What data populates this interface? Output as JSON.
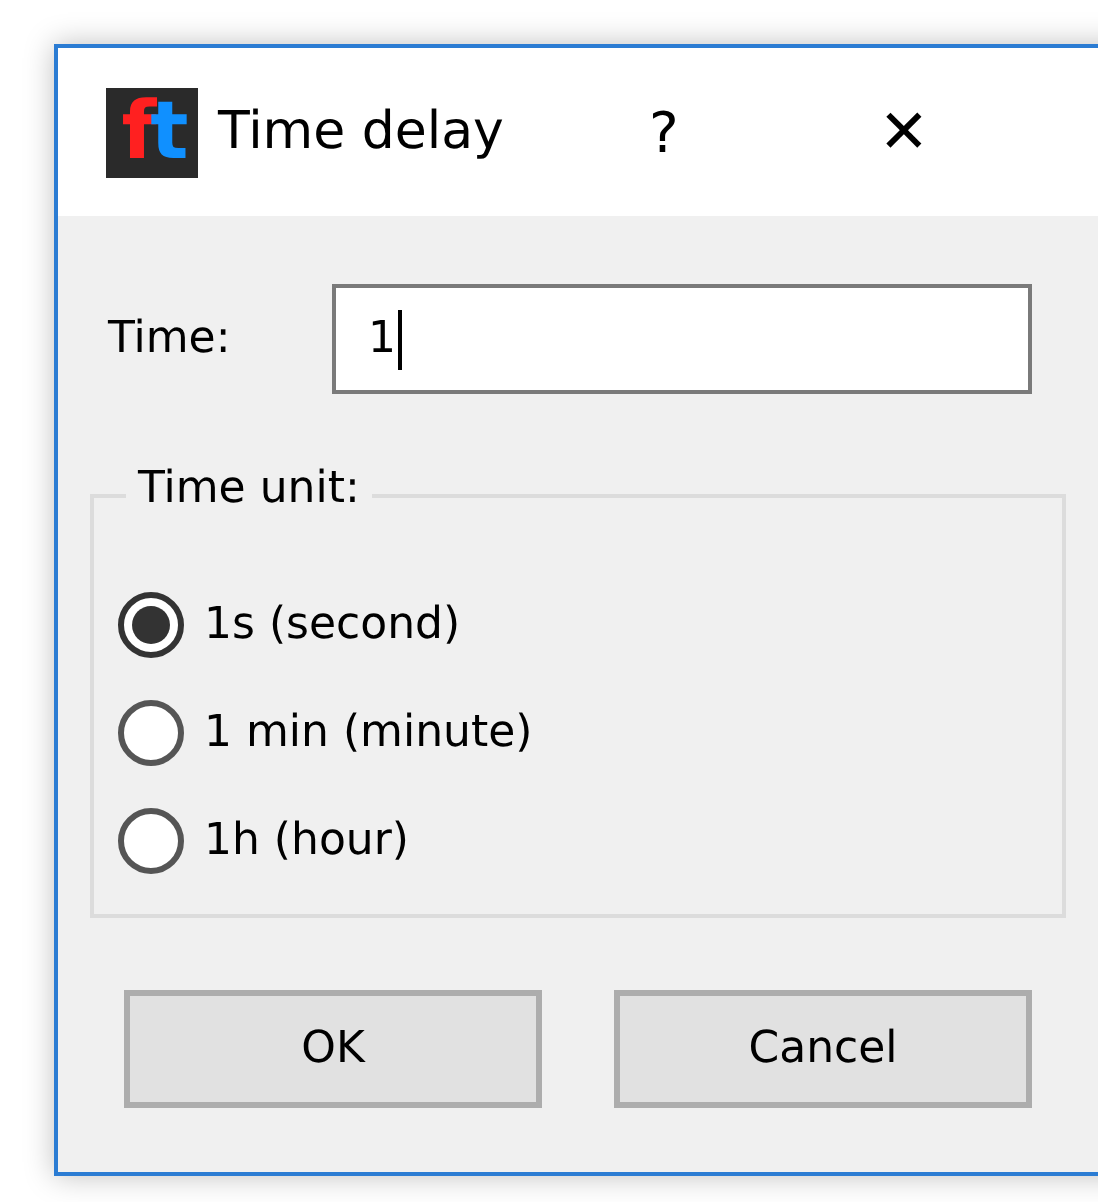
{
  "window": {
    "logo": "ft",
    "title": "Time delay",
    "help": "?",
    "close": "✕"
  },
  "time": {
    "label": "Time:",
    "value": "1",
    "focused": true
  },
  "time_unit": {
    "legend": "Time unit:",
    "options": [
      {
        "label": "1s (second)",
        "selected": true
      },
      {
        "label": "1 min (minute)",
        "selected": false
      },
      {
        "label": "1h (hour)",
        "selected": false
      }
    ]
  },
  "buttons": [
    "OK",
    "Cancel"
  ]
}
